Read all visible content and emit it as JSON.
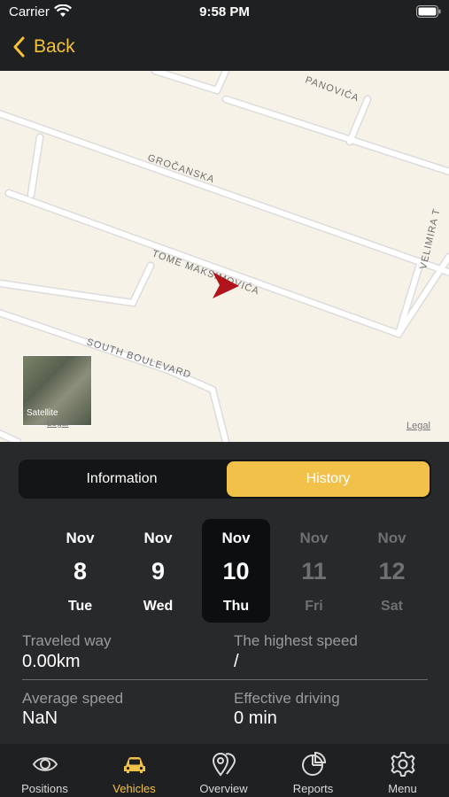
{
  "status": {
    "carrier": "Carrier",
    "time": "9:58 PM"
  },
  "nav": {
    "back_label": "Back"
  },
  "map": {
    "roads": [
      "GROČANSKA",
      "TOME MAKSIMOVIĆA",
      "SOUTH BOULEVARD",
      "VELIMIRA T",
      "PANOVIĆA"
    ],
    "satellite_label": "Satellite",
    "legal_small": "Legal",
    "legal_right": "Legal",
    "marker_color": "#b0151c"
  },
  "tabs_segment": {
    "information": "Information",
    "history": "History"
  },
  "days": [
    {
      "month": "Nov",
      "day": "8",
      "weekday": "Tue"
    },
    {
      "month": "Nov",
      "day": "9",
      "weekday": "Wed"
    },
    {
      "month": "Nov",
      "day": "10",
      "weekday": "Thu"
    },
    {
      "month": "Nov",
      "day": "11",
      "weekday": "Fri"
    },
    {
      "month": "Nov",
      "day": "12",
      "weekday": "Sat"
    }
  ],
  "stats": {
    "traveled_label": "Traveled way",
    "traveled_value": "0.00km",
    "highest_label": "The highest speed",
    "highest_value": "/",
    "average_label": "Average speed",
    "average_value": "NaN",
    "effective_label": "Effective driving",
    "effective_value": "0 min"
  },
  "tabbar": [
    {
      "label": "Positions",
      "icon": "eye-icon"
    },
    {
      "label": "Vehicles",
      "icon": "car-icon"
    },
    {
      "label": "Overview",
      "icon": "map-pin-icon"
    },
    {
      "label": "Reports",
      "icon": "pie-chart-icon"
    },
    {
      "label": "Menu",
      "icon": "gear-icon"
    }
  ],
  "colors": {
    "accent": "#f2c14a",
    "background": "#28292b",
    "bar": "#1f2022"
  }
}
